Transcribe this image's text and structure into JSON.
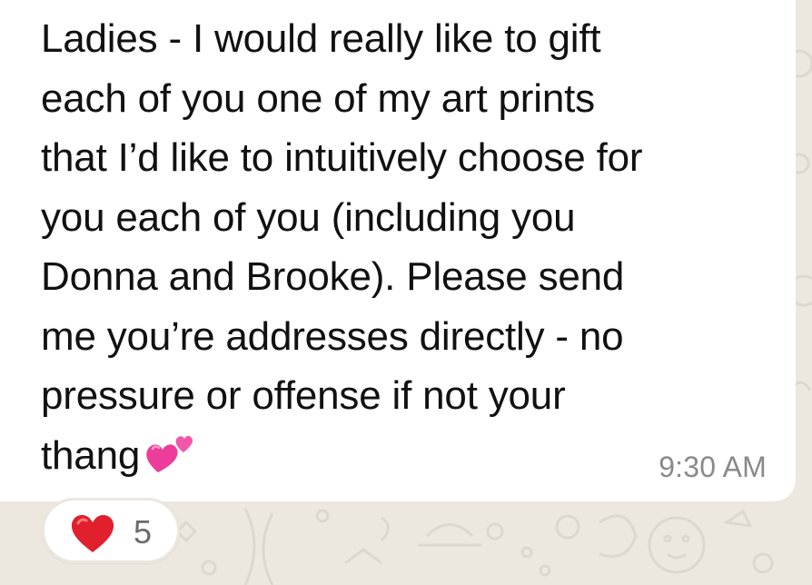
{
  "message": {
    "text": "Ladies - I would really like to gift\neach of you one of my art prints\nthat I’d like to intuitively choose for\nyou each of you (including you\nDonna and Brooke). Please send\nme you’re addresses directly - no\npressure or offense if not your\nthang",
    "emoji": "two-hearts",
    "timestamp": "9:30 AM"
  },
  "reaction": {
    "emoji": "red-heart",
    "count": "5"
  },
  "colors": {
    "wallpaper": "#ece8e0",
    "bubble": "#ffffff",
    "text": "#111111",
    "timestamp": "#8a8a8a",
    "heart": "#e0202c",
    "two_hearts": "#ee3c9a"
  }
}
